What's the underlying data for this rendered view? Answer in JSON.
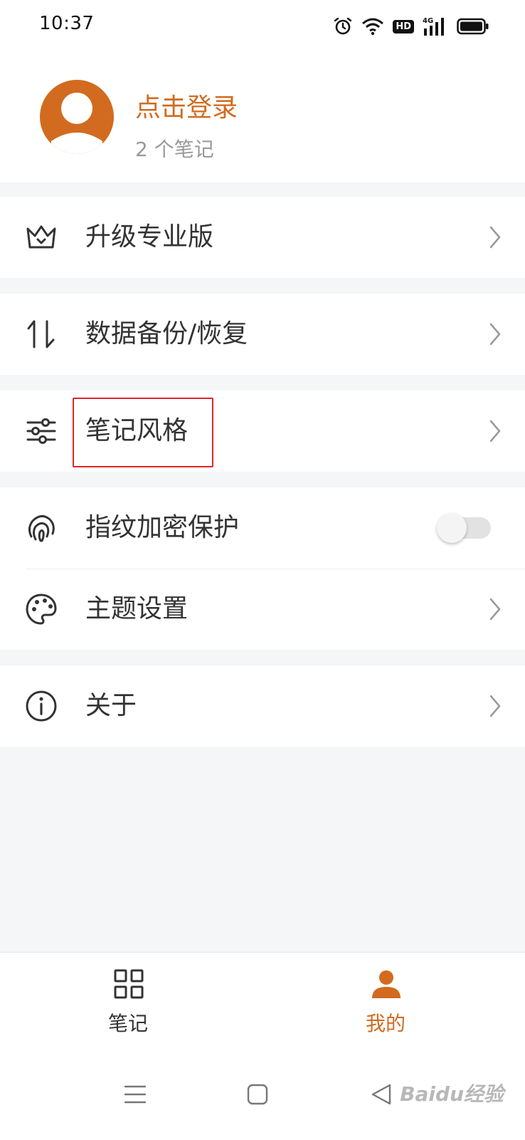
{
  "status_bar": {
    "time": "10:37",
    "hd_badge": "HD",
    "network": "4G",
    "icons": [
      "alarm-icon",
      "wifi-icon",
      "hd-icon",
      "signal-icon",
      "battery-icon"
    ]
  },
  "profile": {
    "login_label": "点击登录",
    "note_count": "2 个笔记"
  },
  "menu": {
    "upgrade": "升级专业版",
    "backup": "数据备份/恢复",
    "note_style": "笔记风格",
    "fingerprint": "指纹加密保护",
    "theme": "主题设置",
    "about": "关于"
  },
  "fingerprint_toggle": {
    "on": false
  },
  "tabs": {
    "notes": "笔记",
    "mine": "我的"
  },
  "watermark": "Baidu经验",
  "colors": {
    "accent": "#d26b1f",
    "background": "#f5f6f8",
    "highlight": "#e0252b",
    "text": "#333333",
    "muted": "#999999"
  }
}
